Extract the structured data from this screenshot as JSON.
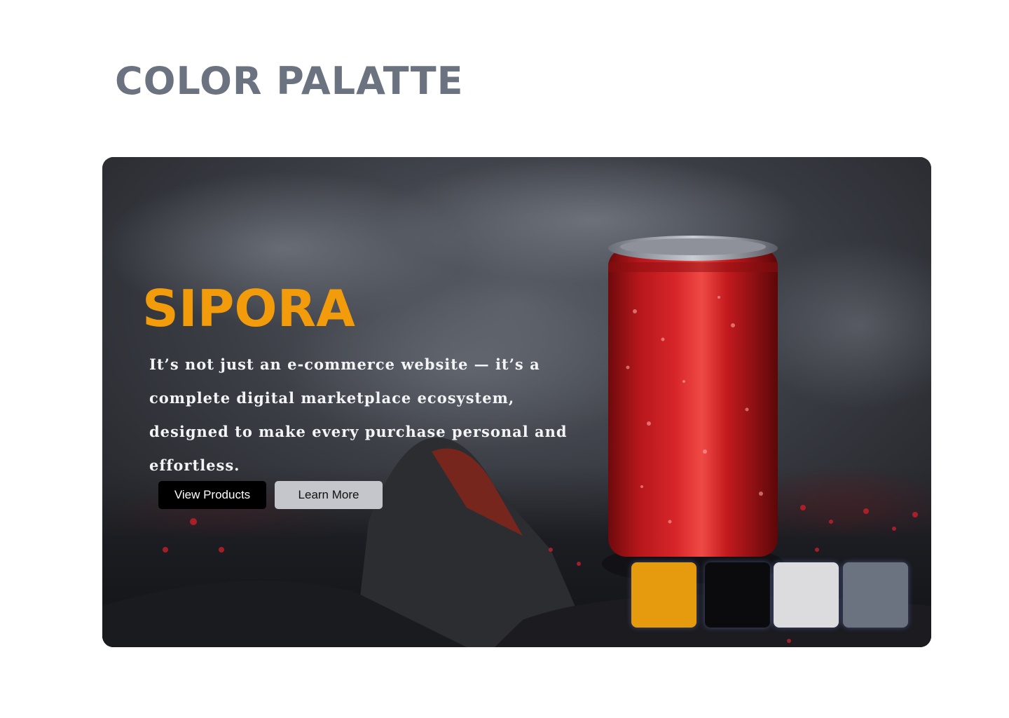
{
  "page": {
    "title": "COLOR PALATTE"
  },
  "hero": {
    "brand": "SIPORA",
    "tagline": "It’s not just an e-commerce website — it’s a complete digital marketplace ecosystem, designed to make every purchase personal and effortless.",
    "buttons": {
      "primary_label": "View Products",
      "secondary_label": "Learn More"
    },
    "image": {
      "subject": "red soda can on dark rocks",
      "icon": "soda-can-photo"
    }
  },
  "palette": {
    "swatches": [
      {
        "name": "amber",
        "color": "#e69a0d"
      },
      {
        "name": "black",
        "color": "#0b0b0d"
      },
      {
        "name": "light-gray",
        "color": "#dcdcdf"
      },
      {
        "name": "slate-gray",
        "color": "#6b7280"
      }
    ]
  },
  "colors": {
    "title": "#6b7280",
    "brand": "#f39c0b",
    "tagline": "#f3f4f6",
    "primary_button_bg": "#000000",
    "secondary_button_bg": "#c4c6cc"
  }
}
